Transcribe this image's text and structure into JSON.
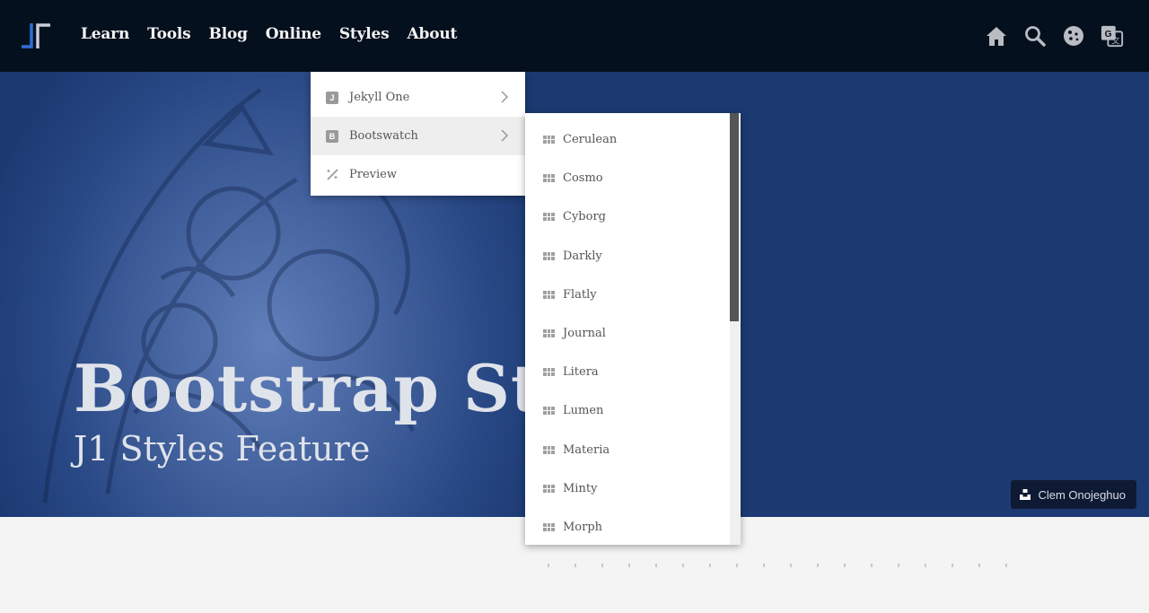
{
  "nav": {
    "items": [
      "Learn",
      "Tools",
      "Blog",
      "Online",
      "Styles",
      "About"
    ]
  },
  "quick_icons": [
    "home-icon",
    "search-icon",
    "cookie-icon",
    "translate-icon"
  ],
  "hero": {
    "title": "Bootstrap Styles",
    "subtitle": "J1 Styles Feature",
    "credit": "Clem Onojeghuo"
  },
  "styles_menu": {
    "items": [
      {
        "label": "Jekyll One",
        "icon": "J"
      },
      {
        "label": "Bootswatch",
        "icon": "B"
      },
      {
        "label": "Preview",
        "icon": "wand-icon"
      }
    ]
  },
  "bootswatch_menu": {
    "items": [
      "Cerulean",
      "Cosmo",
      "Cyborg",
      "Darkly",
      "Flatly",
      "Journal",
      "Litera",
      "Lumen",
      "Materia",
      "Minty",
      "Morph"
    ]
  },
  "colors": {
    "header_bg": "#05101e",
    "hero_bg": "#1c3a72",
    "accent": "#2f6fd6"
  }
}
